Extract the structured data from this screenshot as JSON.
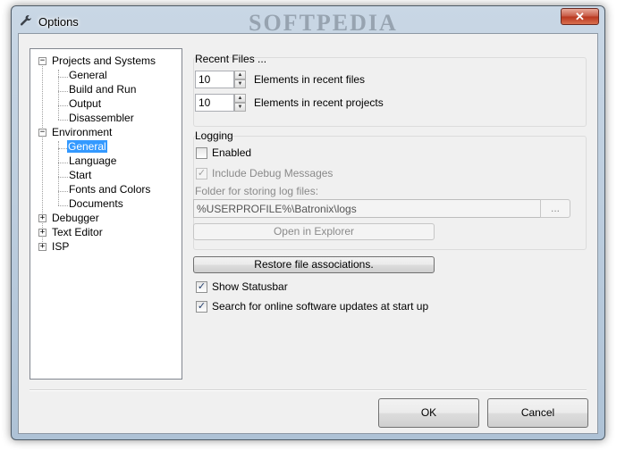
{
  "window": {
    "title": "Options",
    "close_glyph": "✕",
    "watermark": "SOFTPEDIA"
  },
  "tree": {
    "nodes": [
      {
        "label": "Projects and Systems",
        "expander": "−"
      },
      {
        "label": "General"
      },
      {
        "label": "Build and Run"
      },
      {
        "label": "Output"
      },
      {
        "label": "Disassembler"
      },
      {
        "label": "Environment",
        "expander": "−"
      },
      {
        "label": "General",
        "selected": true
      },
      {
        "label": "Language"
      },
      {
        "label": "Start"
      },
      {
        "label": "Fonts and Colors"
      },
      {
        "label": "Documents"
      },
      {
        "label": "Debugger",
        "expander": "+"
      },
      {
        "label": "Text Editor",
        "expander": "+"
      },
      {
        "label": "ISP",
        "expander": "+"
      }
    ]
  },
  "recent_files": {
    "title": "Recent Files ...",
    "elements_value": "10",
    "elements_label": "Elements in recent files",
    "projects_value": "10",
    "projects_label": "Elements in recent projects",
    "spin_up": "▲",
    "spin_down": "▼"
  },
  "logging": {
    "title": "Logging",
    "enabled_label": "Enabled",
    "enabled_checked": false,
    "debug_label": "Include Debug Messages",
    "debug_checked": true,
    "folder_label": "Folder for storing log files:",
    "folder_value": "%USERPROFILE%\\Batronix\\logs",
    "browse_label": "...",
    "open_explorer_label": "Open in Explorer"
  },
  "general": {
    "restore_label": "Restore file associations.",
    "statusbar_label": "Show Statusbar",
    "statusbar_checked": true,
    "updates_label": "Search for online software updates at start up",
    "updates_checked": true,
    "check_glyph": "✓"
  },
  "footer": {
    "ok_label": "OK",
    "cancel_label": "Cancel"
  },
  "icons": {
    "title": "wrench-icon",
    "close": "close-icon"
  }
}
